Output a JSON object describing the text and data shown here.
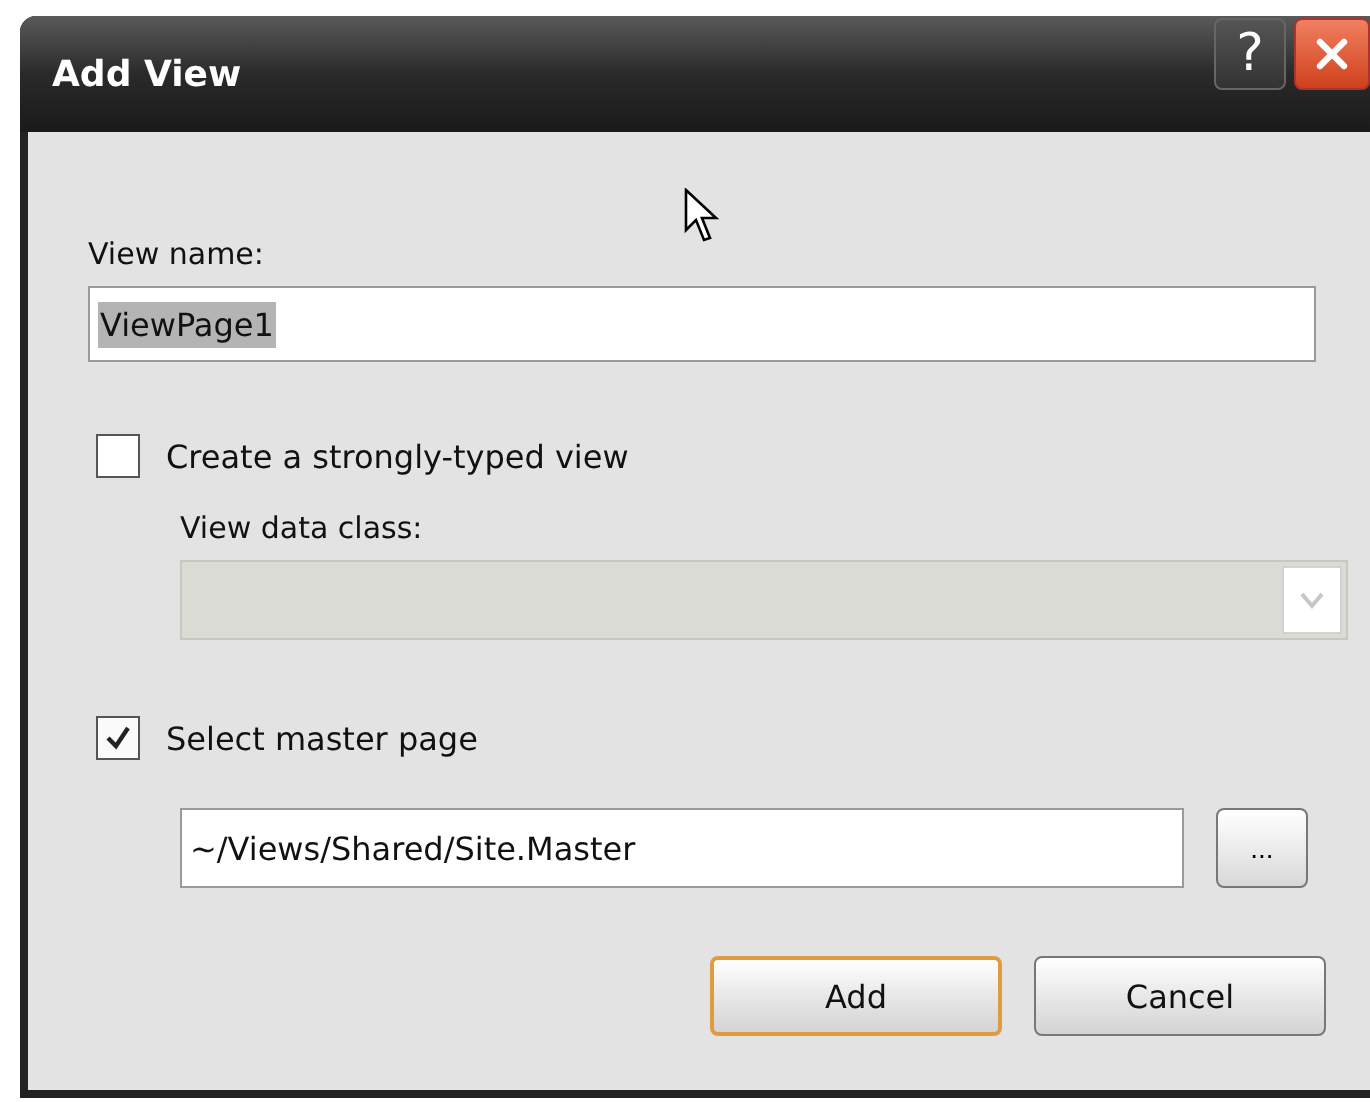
{
  "window": {
    "title": "Add View",
    "help_button": "?"
  },
  "view_name": {
    "label": "View name:",
    "value": "ViewPage1",
    "selected_text": true
  },
  "strongly_typed": {
    "label": "Create a strongly-typed view",
    "checked": false
  },
  "view_data_class": {
    "label": "View data class:",
    "disabled": true
  },
  "master_page": {
    "label": "Select master page",
    "checked": true,
    "value": "~/Views/Shared/Site.Master",
    "browse": "..."
  },
  "buttons": [
    {
      "label": "Add",
      "default": true
    },
    {
      "label": "Cancel",
      "default": false
    }
  ]
}
